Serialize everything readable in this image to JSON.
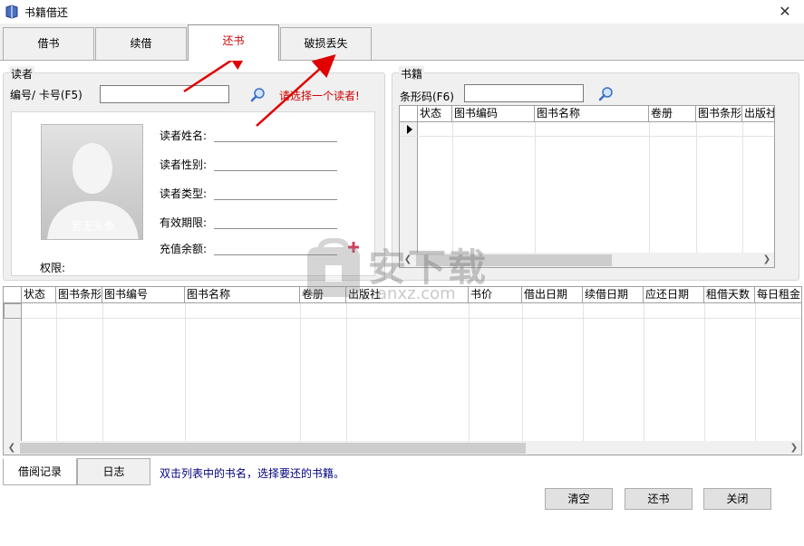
{
  "window": {
    "title": "书籍借还",
    "close_glyph": "✕"
  },
  "tabs": [
    {
      "label": "借书"
    },
    {
      "label": "续借"
    },
    {
      "label": "还书"
    },
    {
      "label": "破损丢失"
    }
  ],
  "reader": {
    "group_label": "读者",
    "id_label": "编号/ 卡号(F5)",
    "id_value": "",
    "prompt": "请选择一个读者!",
    "photo_caption": "暂无头像",
    "fields": [
      {
        "label": "读者姓名:"
      },
      {
        "label": "读者性别:"
      },
      {
        "label": "读者类型:"
      },
      {
        "label": "有效期限:"
      },
      {
        "label": "充值余额:"
      }
    ],
    "permission_label": "权限:"
  },
  "books": {
    "group_label": "书籍",
    "barcode_label": "条形码(F6)",
    "barcode_value": "",
    "columns": [
      "状态",
      "图书编码",
      "图书名称",
      "卷册",
      "图书条形",
      "出版社"
    ]
  },
  "loans": {
    "columns": [
      "状态",
      "图书条形",
      "图书编号",
      "图书名称",
      "卷册",
      "出版社",
      "书价",
      "借出日期",
      "续借日期",
      "应还日期",
      "租借天数",
      "每日租金"
    ]
  },
  "bottom_tabs": [
    {
      "label": "借阅记录"
    },
    {
      "label": "日志"
    }
  ],
  "hint": "双击列表中的书名，选择要还的书籍。",
  "buttons": {
    "clear": "清空",
    "return": "还书",
    "close": "关闭"
  },
  "watermark": {
    "brand": "安下载",
    "domain": "anxz.com"
  },
  "colors": {
    "accent_red": "#d00000",
    "hint_blue": "#000080",
    "annotation_arrow": "#e00000"
  }
}
